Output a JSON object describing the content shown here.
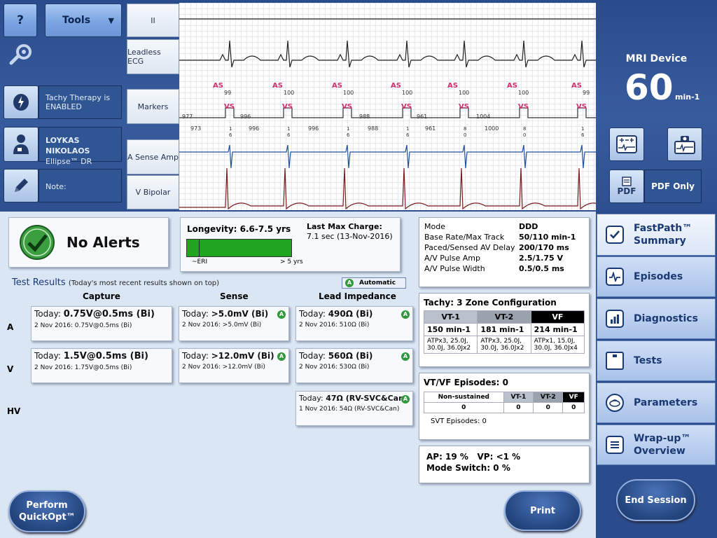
{
  "header": {
    "help_label": "?",
    "tools_label": "Tools",
    "tachy_therapy": "Tachy Therapy is ENABLED",
    "patient_name": "LOYKAS NIKOLAOS",
    "device_name": "Ellipse™ DR",
    "note_label": "Note:"
  },
  "leads": [
    "II",
    "Leadless ECG",
    "Markers",
    "A Sense Amp",
    "V Bipolar"
  ],
  "markers": {
    "as_label": "AS",
    "vs_label": "VS",
    "as_values": [
      "99",
      "100",
      "100",
      "100",
      "100",
      "100",
      "99"
    ],
    "vs_top": [
      "977",
      "996",
      "",
      "988",
      "961",
      "1004",
      ""
    ],
    "vs_bottom": [
      "973",
      "996",
      "996",
      "988",
      "961",
      "1000",
      ""
    ],
    "vs_sub": [
      "1\n6",
      "1\n6",
      "1\n6",
      "1\n6",
      "8\n0",
      "8\n0",
      "1\n6",
      "8\n4"
    ]
  },
  "device_rate": {
    "mri_label": "MRI Device",
    "rate": "60",
    "unit": "min-1",
    "pdf_label": "PDF Only",
    "pdf_icon_label": "PDF"
  },
  "alerts": {
    "status": "No Alerts"
  },
  "longevity": {
    "label": "Longevity: 6.6-7.5 yrs",
    "eri": "~ERI",
    "gt5": "> 5 yrs",
    "fill_percent": 100,
    "last_max_charge_label": "Last Max Charge:",
    "last_max_charge_value": "7.1 sec (13-Nov-2016)"
  },
  "test_results": {
    "title": "Test Results",
    "subtitle": "(Today's most recent results shown on top)",
    "automatic": "Automatic",
    "col_capture": "Capture",
    "col_sense": "Sense",
    "col_impedance": "Lead Impedance",
    "rows": [
      {
        "label": "A",
        "capture_today": "0.75V@0.5ms (Bi)",
        "capture_prev": "2 Nov 2016: 0.75V@0.5ms (Bi)",
        "sense_today": ">5.0mV (Bi)",
        "sense_prev": "2 Nov 2016: >5.0mV (Bi)",
        "imp_today": "490Ω (Bi)",
        "imp_prev": "2 Nov 2016: 510Ω (Bi)"
      },
      {
        "label": "V",
        "capture_today": "1.5V@0.5ms (Bi)",
        "capture_prev": "2 Nov 2016: 1.75V@0.5ms (Bi)",
        "sense_today": ">12.0mV (Bi)",
        "sense_prev": "2 Nov 2016: >12.0mV (Bi)",
        "imp_today": "560Ω (Bi)",
        "imp_prev": "2 Nov 2016: 530Ω (Bi)"
      },
      {
        "label": "HV",
        "imp_today": "47Ω (RV-SVC&Can)",
        "imp_prev": "1 Nov 2016: 54Ω (RV-SVC&Can)"
      }
    ],
    "today_label": "Today:"
  },
  "params": {
    "rows": [
      {
        "k": "Mode",
        "v": "DDD"
      },
      {
        "k": "Base Rate/Max Track",
        "v": "50/110 min-1"
      },
      {
        "k": "Paced/Sensed AV Delay",
        "v": "200/170 ms"
      },
      {
        "k": "A/V Pulse Amp",
        "v": "2.5/1.75 V"
      },
      {
        "k": "A/V Pulse Width",
        "v": "0.5/0.5 ms"
      }
    ]
  },
  "tachy": {
    "title": "Tachy: 3 Zone Configuration",
    "zones": [
      {
        "name": "VT-1",
        "rate": "150 min-1",
        "therapy": "ATPx3, 25.0J, 30.0J, 36.0Jx2"
      },
      {
        "name": "VT-2",
        "rate": "181 min-1",
        "therapy": "ATPx3, 25.0J, 30.0J, 36.0Jx2"
      },
      {
        "name": "VF",
        "rate": "214 min-1",
        "therapy": "ATPx1, 15.0J, 30.0J, 36.0Jx4"
      }
    ]
  },
  "episodes": {
    "title": "VT/VF Episodes: 0",
    "headers": [
      "Non-sustained",
      "VT-1",
      "VT-2",
      "VF"
    ],
    "values": [
      "0",
      "0",
      "0",
      "0"
    ],
    "svt": "SVT Episodes: 0"
  },
  "pacing": {
    "ap": "AP: 19 %",
    "vp": "VP: <1 %",
    "mode_switch": "Mode Switch: 0 %"
  },
  "nav": {
    "fastpath": "FastPath™ Summary",
    "episodes": "Episodes",
    "diagnostics": "Diagnostics",
    "tests": "Tests",
    "parameters": "Parameters",
    "wrapup": "Wrap-up™ Overview"
  },
  "actions": {
    "quickopt": "Perform QuickOpt™",
    "print": "Print",
    "end_session": "End Session"
  },
  "colors": {
    "marker_pink": "#d0306a",
    "alert_green": "#2e9a3a",
    "nav_text": "#1a3872"
  }
}
